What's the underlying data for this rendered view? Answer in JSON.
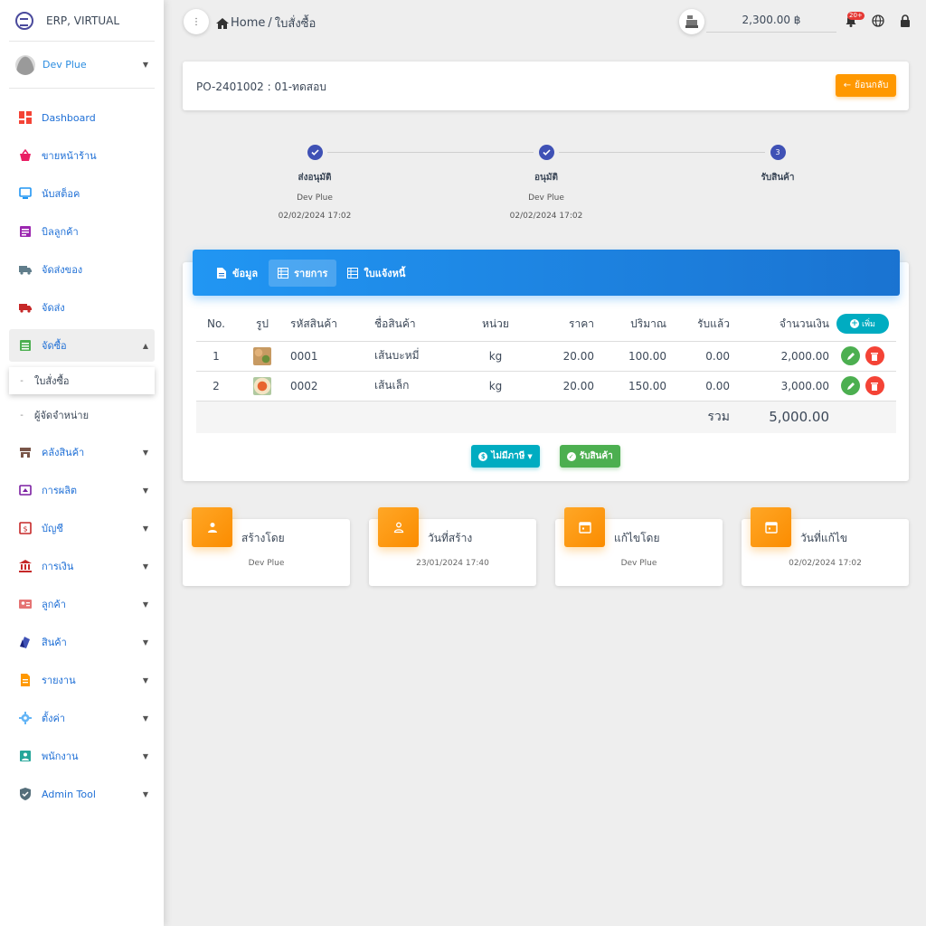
{
  "app": {
    "brand": "ERP, VIRTUAL",
    "user": "Dev Plue"
  },
  "sidebar": {
    "items": [
      {
        "label": "Dashboard",
        "icon": "dashboard-icon",
        "color": "#f44336"
      },
      {
        "label": "ขายหน้าร้าน",
        "icon": "basket-icon",
        "color": "#e91e63"
      },
      {
        "label": "นับสต็อค",
        "icon": "monitor-icon",
        "color": "#2196f3"
      },
      {
        "label": "บิลลูกค้า",
        "icon": "bill-icon",
        "color": "#9c27b0"
      },
      {
        "label": "จัดส่งของ",
        "icon": "truck-icon",
        "color": "#607d8b"
      },
      {
        "label": "จัดส่ง",
        "icon": "truck-icon",
        "color": "#c62828"
      },
      {
        "label": "จัดซื้อ",
        "icon": "list-icon",
        "color": "#4caf50"
      }
    ],
    "sub_items": [
      {
        "label": "ใบสั่งซื้อ"
      },
      {
        "label": "ผู้จัดจำหน่าย"
      }
    ],
    "items2": [
      {
        "label": "คลังสินค้า",
        "icon": "store-icon",
        "color": "#795548"
      },
      {
        "label": "การผลิต",
        "icon": "factory-icon",
        "color": "#7b1fa2"
      },
      {
        "label": "บัญชี",
        "icon": "dollar-icon",
        "color": "#c62828"
      },
      {
        "label": "การเงิน",
        "icon": "bank-icon",
        "color": "#c62828"
      },
      {
        "label": "ลูกค้า",
        "icon": "contact-icon",
        "color": "#e57373"
      },
      {
        "label": "สินค้า",
        "icon": "tag-icon",
        "color": "#3f51b5"
      },
      {
        "label": "รายงาน",
        "icon": "report-icon",
        "color": "#ff9800"
      },
      {
        "label": "ตั้งค่า",
        "icon": "gear-icon",
        "color": "#64b5f6"
      },
      {
        "label": "พนักงาน",
        "icon": "employee-icon",
        "color": "#26a69a"
      },
      {
        "label": "Admin Tool",
        "icon": "shield-icon",
        "color": "#546e7a"
      }
    ]
  },
  "topbar": {
    "breadcrumb_home": "Home",
    "breadcrumb_sep": "/",
    "breadcrumb_page": "ใบสั่งซื้อ",
    "balance": "2,300.00 ฿",
    "notification_badge": "20+"
  },
  "po": {
    "title": "PO-2401002 : 01-ทดสอบ",
    "back_label": "ย้อนกลับ"
  },
  "steps": [
    {
      "label": "ส่งอนุมัติ",
      "by": "Dev Plue",
      "date": "02/02/2024 17:02",
      "status": "done"
    },
    {
      "label": "อนุมัติ",
      "by": "Dev Plue",
      "date": "02/02/2024 17:02",
      "status": "done"
    },
    {
      "label": "รับสินค้า",
      "by": "",
      "date": "",
      "status": "current",
      "number": "3"
    }
  ],
  "tabs": [
    {
      "label": "ข้อมูล",
      "icon": "document-icon"
    },
    {
      "label": "รายการ",
      "icon": "table-icon",
      "active": true
    },
    {
      "label": "ใบแจ้งหนี้",
      "icon": "table-icon"
    }
  ],
  "table": {
    "headers": {
      "no": "No.",
      "image": "รูป",
      "code": "รหัสสินค้า",
      "name": "ชื่อสินค้า",
      "unit": "หน่วย",
      "price": "ราคา",
      "qty": "ปริมาณ",
      "received": "รับแล้ว",
      "amount": "จำนวนเงิน"
    },
    "add_label": "เพิ่ม",
    "rows": [
      {
        "no": "1",
        "code": "0001",
        "name": "เส้นบะหมี่",
        "unit": "kg",
        "price": "20.00",
        "qty": "100.00",
        "received": "0.00",
        "amount": "2,000.00"
      },
      {
        "no": "2",
        "code": "0002",
        "name": "เส้นเล็ก",
        "unit": "kg",
        "price": "20.00",
        "qty": "150.00",
        "received": "0.00",
        "amount": "3,000.00"
      }
    ],
    "total_label": "รวม",
    "total_value": "5,000.00"
  },
  "actions": {
    "tax_label": "ไม่มีภาษี",
    "receive_label": "รับสินค้า"
  },
  "info": [
    {
      "title": "สร้างโดย",
      "value": "Dev Plue",
      "icon": "person-icon"
    },
    {
      "title": "วันที่สร้าง",
      "value": "23/01/2024 17:40",
      "icon": "person-outline-icon"
    },
    {
      "title": "แก้ไขโดย",
      "value": "Dev Plue",
      "icon": "calendar-icon"
    },
    {
      "title": "วันที่แก้ไข",
      "value": "02/02/2024 17:02",
      "icon": "calendar-icon"
    }
  ],
  "colors": {
    "accent": "#2196f3",
    "orange": "#ff9800",
    "step": "#3f51b5",
    "green": "#4caf50",
    "red": "#f44336",
    "cyan": "#00acc1"
  }
}
